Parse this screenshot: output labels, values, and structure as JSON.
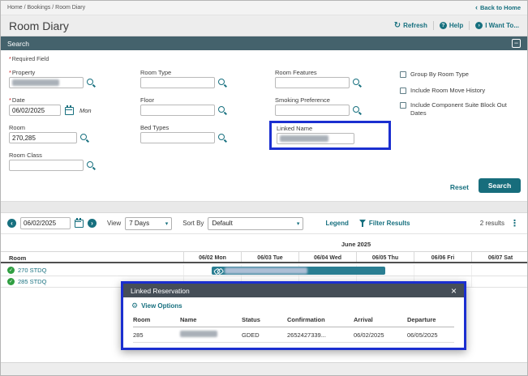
{
  "breadcrumb": {
    "path": "Home / Bookings / Room Diary",
    "back_label": "Back to Home"
  },
  "header": {
    "title": "Room Diary",
    "actions": {
      "refresh": "Refresh",
      "help": "Help",
      "i_want_to": "I Want To..."
    }
  },
  "search": {
    "panel_title": "Search",
    "required_marker": "*",
    "required_note": "Required Field",
    "labels": {
      "property": "Property",
      "date": "Date",
      "room": "Room",
      "room_class": "Room Class",
      "room_type": "Room Type",
      "floor": "Floor",
      "bed_types": "Bed Types",
      "room_features": "Room Features",
      "smoking_preference": "Smoking Preference",
      "linked_name": "Linked Name"
    },
    "values": {
      "date": "06/02/2025",
      "date_day": "Mon",
      "room": "270,285"
    },
    "checkboxes": [
      "Group By Room Type",
      "Include Room Move History",
      "Include Component Suite Block Out Dates"
    ],
    "reset_label": "Reset",
    "search_label": "Search"
  },
  "toolbar": {
    "date_value": "06/02/2025",
    "view_label": "View",
    "view_value": "7 Days",
    "sort_label": "Sort By",
    "sort_value": "Default",
    "legend_label": "Legend",
    "filter_label": "Filter Results",
    "results_label": "2 results"
  },
  "diary": {
    "month_label": "June 2025",
    "room_column": "Room",
    "days": [
      "06/02 Mon",
      "06/03 Tue",
      "06/04 Wed",
      "06/05 Thu",
      "06/06 Fri",
      "06/07 Sat"
    ],
    "rooms": [
      {
        "label": "270 STDQ"
      },
      {
        "label": "285 STDQ"
      }
    ]
  },
  "dialog": {
    "title": "Linked Reservation",
    "view_options_label": "View Options",
    "columns": [
      "Room",
      "Name",
      "Status",
      "Confirmation",
      "Arrival",
      "Departure"
    ],
    "row": {
      "room": "285",
      "status": "GDED",
      "confirmation": "2652427339...",
      "arrival": "06/02/2025",
      "departure": "06/05/2025"
    }
  },
  "icons": {
    "back": "‹",
    "refresh": "↻",
    "help": "?",
    "arrow": "›",
    "collapse": "−",
    "prev": "‹",
    "next": "›",
    "caret": "▾",
    "kebab": "⋮",
    "check": "✓",
    "gear": "⚙",
    "close": "×"
  },
  "colors": {
    "teal_accent": "#17707f",
    "panel_header": "#44626c",
    "dialog_header": "#454e57",
    "highlight_blue": "#1b2fd0",
    "reservation_bar": "#2a7e92",
    "room_status_green": "#2f9e41"
  }
}
